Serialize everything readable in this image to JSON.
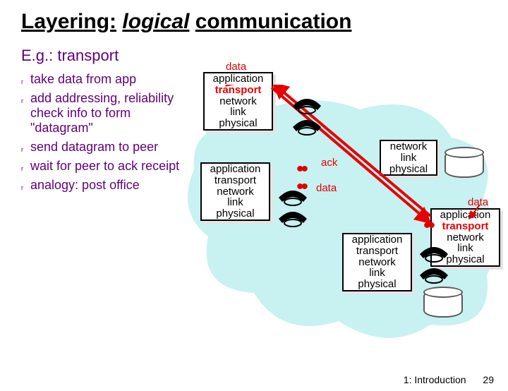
{
  "title_parts": {
    "a": "Layering:",
    "b": "logical",
    "c": "communication"
  },
  "subtitle": "E.g.: transport",
  "bullets": [
    "take data from app",
    "add addressing, reliability check info to form \"datagram\"",
    "send datagram to peer",
    "wait for peer to ack receipt",
    "analogy: post office"
  ],
  "stack_layers": {
    "application": "application",
    "transport": "transport",
    "network": "network",
    "link": "link",
    "physical": "physical"
  },
  "router_layers": [
    "network",
    "link",
    "physical"
  ],
  "annot": {
    "data": "data",
    "ack": "ack"
  },
  "footer": {
    "section": "1: Introduction",
    "page": "29"
  }
}
